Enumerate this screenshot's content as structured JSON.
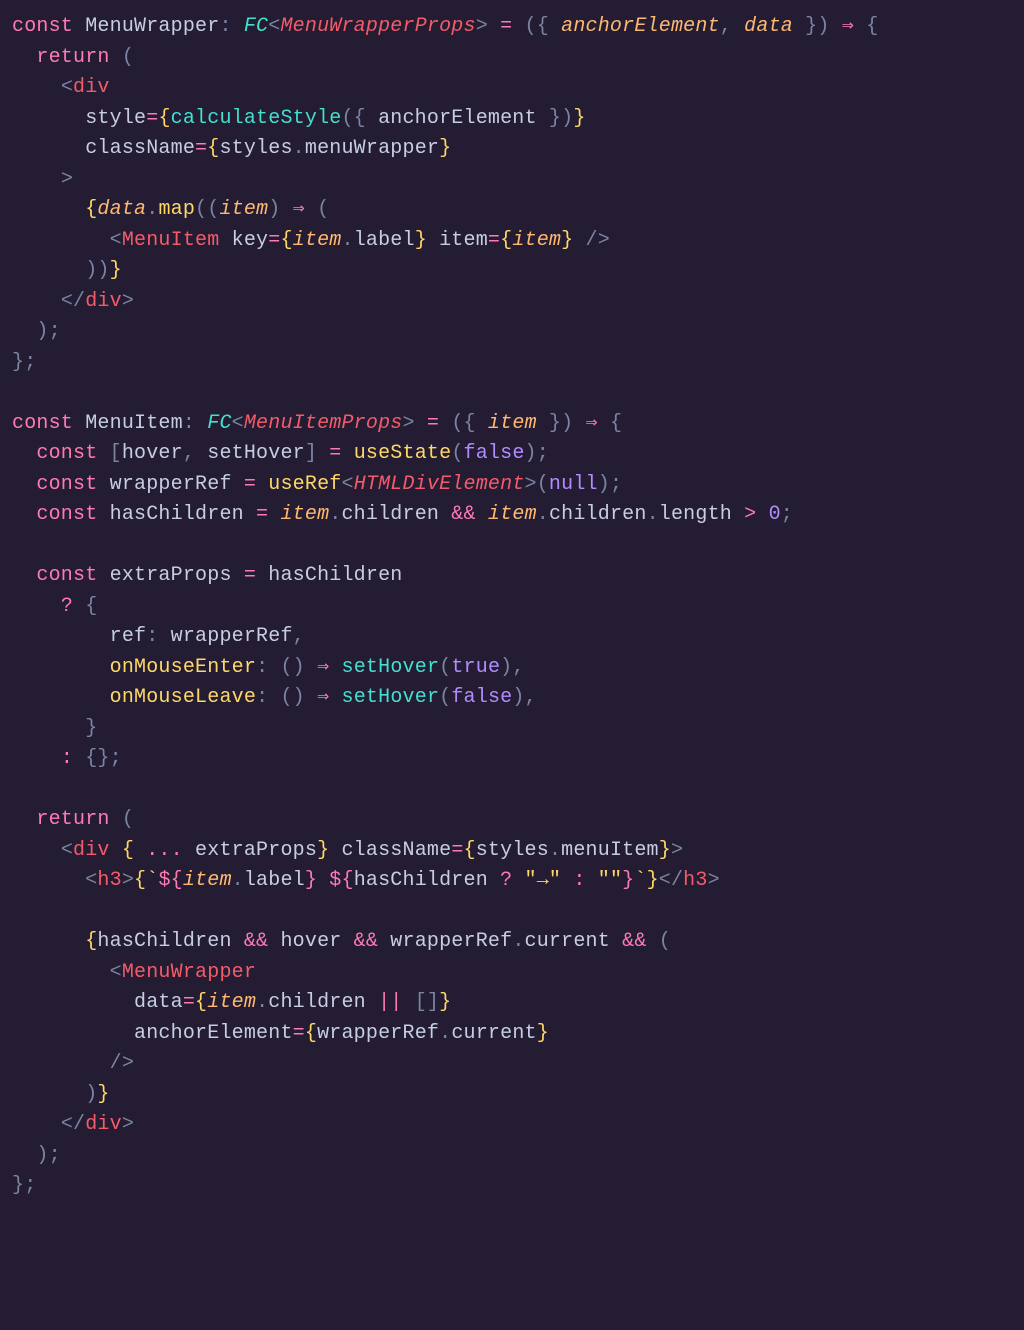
{
  "code": {
    "lines": [
      [
        {
          "t": "const ",
          "c": "c-kw"
        },
        {
          "t": "MenuWrapper",
          "c": "c-ident"
        },
        {
          "t": ": ",
          "c": "c-punc"
        },
        {
          "t": "FC",
          "c": "c-type ital"
        },
        {
          "t": "<",
          "c": "c-punc"
        },
        {
          "t": "MenuWrapperProps",
          "c": "c-comp ital"
        },
        {
          "t": ">",
          "c": "c-punc"
        },
        {
          "t": " = ",
          "c": "c-op"
        },
        {
          "t": "(",
          "c": "c-punc"
        },
        {
          "t": "{ ",
          "c": "c-punc"
        },
        {
          "t": "anchorElement",
          "c": "c-param"
        },
        {
          "t": ", ",
          "c": "c-punc"
        },
        {
          "t": "data",
          "c": "c-param"
        },
        {
          "t": " }",
          "c": "c-punc"
        },
        {
          "t": ")",
          "c": "c-punc"
        },
        {
          "t": " ⇒ ",
          "c": "c-op"
        },
        {
          "t": "{",
          "c": "c-punc"
        }
      ],
      [
        {
          "t": "  ",
          "c": ""
        },
        {
          "t": "return ",
          "c": "c-kw"
        },
        {
          "t": "(",
          "c": "c-punc"
        }
      ],
      [
        {
          "t": "    ",
          "c": ""
        },
        {
          "t": "<",
          "c": "c-tagp"
        },
        {
          "t": "div",
          "c": "c-comp"
        }
      ],
      [
        {
          "t": "      ",
          "c": ""
        },
        {
          "t": "style",
          "c": "c-attr"
        },
        {
          "t": "=",
          "c": "c-op"
        },
        {
          "t": "{",
          "c": "c-brkt"
        },
        {
          "t": "calculateStyle",
          "c": "c-type"
        },
        {
          "t": "(",
          "c": "c-punc"
        },
        {
          "t": "{ ",
          "c": "c-punc"
        },
        {
          "t": "anchorElement",
          "c": "c-ident"
        },
        {
          "t": " }",
          "c": "c-punc"
        },
        {
          "t": ")",
          "c": "c-punc"
        },
        {
          "t": "}",
          "c": "c-brkt"
        }
      ],
      [
        {
          "t": "      ",
          "c": ""
        },
        {
          "t": "className",
          "c": "c-attr"
        },
        {
          "t": "=",
          "c": "c-op"
        },
        {
          "t": "{",
          "c": "c-brkt"
        },
        {
          "t": "styles",
          "c": "c-ident"
        },
        {
          "t": ".",
          "c": "c-punc"
        },
        {
          "t": "menuWrapper",
          "c": "c-prop"
        },
        {
          "t": "}",
          "c": "c-brkt"
        }
      ],
      [
        {
          "t": "    ",
          "c": ""
        },
        {
          "t": ">",
          "c": "c-tagp"
        }
      ],
      [
        {
          "t": "      ",
          "c": ""
        },
        {
          "t": "{",
          "c": "c-brkt"
        },
        {
          "t": "data",
          "c": "c-param"
        },
        {
          "t": ".",
          "c": "c-punc"
        },
        {
          "t": "map",
          "c": "c-fn2"
        },
        {
          "t": "((",
          "c": "c-punc"
        },
        {
          "t": "item",
          "c": "c-param"
        },
        {
          "t": ")",
          "c": "c-punc"
        },
        {
          "t": " ⇒ ",
          "c": "c-op"
        },
        {
          "t": "(",
          "c": "c-punc"
        }
      ],
      [
        {
          "t": "        ",
          "c": ""
        },
        {
          "t": "<",
          "c": "c-tagp"
        },
        {
          "t": "MenuItem",
          "c": "c-comp"
        },
        {
          "t": " ",
          "c": ""
        },
        {
          "t": "key",
          "c": "c-attr"
        },
        {
          "t": "=",
          "c": "c-op"
        },
        {
          "t": "{",
          "c": "c-brkt"
        },
        {
          "t": "item",
          "c": "c-param"
        },
        {
          "t": ".",
          "c": "c-punc"
        },
        {
          "t": "label",
          "c": "c-prop"
        },
        {
          "t": "}",
          "c": "c-brkt"
        },
        {
          "t": " ",
          "c": ""
        },
        {
          "t": "item",
          "c": "c-attr"
        },
        {
          "t": "=",
          "c": "c-op"
        },
        {
          "t": "{",
          "c": "c-brkt"
        },
        {
          "t": "item",
          "c": "c-param"
        },
        {
          "t": "}",
          "c": "c-brkt"
        },
        {
          "t": " ",
          "c": ""
        },
        {
          "t": "/>",
          "c": "c-tagp"
        }
      ],
      [
        {
          "t": "      ",
          "c": ""
        },
        {
          "t": "))",
          "c": "c-punc"
        },
        {
          "t": "}",
          "c": "c-brkt"
        }
      ],
      [
        {
          "t": "    ",
          "c": ""
        },
        {
          "t": "</",
          "c": "c-tagp"
        },
        {
          "t": "div",
          "c": "c-comp"
        },
        {
          "t": ">",
          "c": "c-tagp"
        }
      ],
      [
        {
          "t": "  ",
          "c": ""
        },
        {
          "t": ")",
          "c": "c-punc"
        },
        {
          "t": ";",
          "c": "c-punc"
        }
      ],
      [
        {
          "t": "}",
          "c": "c-punc"
        },
        {
          "t": ";",
          "c": "c-punc"
        }
      ],
      [
        {
          "t": " ",
          "c": ""
        }
      ],
      [
        {
          "t": "const ",
          "c": "c-kw"
        },
        {
          "t": "MenuItem",
          "c": "c-ident"
        },
        {
          "t": ": ",
          "c": "c-punc"
        },
        {
          "t": "FC",
          "c": "c-type ital"
        },
        {
          "t": "<",
          "c": "c-punc"
        },
        {
          "t": "MenuItemProps",
          "c": "c-comp ital"
        },
        {
          "t": ">",
          "c": "c-punc"
        },
        {
          "t": " = ",
          "c": "c-op"
        },
        {
          "t": "(",
          "c": "c-punc"
        },
        {
          "t": "{ ",
          "c": "c-punc"
        },
        {
          "t": "item",
          "c": "c-param"
        },
        {
          "t": " }",
          "c": "c-punc"
        },
        {
          "t": ")",
          "c": "c-punc"
        },
        {
          "t": " ⇒ ",
          "c": "c-op"
        },
        {
          "t": "{",
          "c": "c-punc"
        }
      ],
      [
        {
          "t": "  ",
          "c": ""
        },
        {
          "t": "const ",
          "c": "c-kw"
        },
        {
          "t": "[",
          "c": "c-punc"
        },
        {
          "t": "hover",
          "c": "c-ident"
        },
        {
          "t": ", ",
          "c": "c-punc"
        },
        {
          "t": "setHover",
          "c": "c-ident"
        },
        {
          "t": "]",
          "c": "c-punc"
        },
        {
          "t": " = ",
          "c": "c-op"
        },
        {
          "t": "useState",
          "c": "c-fn2"
        },
        {
          "t": "(",
          "c": "c-punc"
        },
        {
          "t": "false",
          "c": "c-num"
        },
        {
          "t": ")",
          "c": "c-punc"
        },
        {
          "t": ";",
          "c": "c-punc"
        }
      ],
      [
        {
          "t": "  ",
          "c": ""
        },
        {
          "t": "const ",
          "c": "c-kw"
        },
        {
          "t": "wrapperRef",
          "c": "c-ident"
        },
        {
          "t": " = ",
          "c": "c-op"
        },
        {
          "t": "useRef",
          "c": "c-fn2"
        },
        {
          "t": "<",
          "c": "c-punc"
        },
        {
          "t": "HTMLDivElement",
          "c": "c-comp ital"
        },
        {
          "t": ">",
          "c": "c-punc"
        },
        {
          "t": "(",
          "c": "c-punc"
        },
        {
          "t": "null",
          "c": "c-num"
        },
        {
          "t": ")",
          "c": "c-punc"
        },
        {
          "t": ";",
          "c": "c-punc"
        }
      ],
      [
        {
          "t": "  ",
          "c": ""
        },
        {
          "t": "const ",
          "c": "c-kw"
        },
        {
          "t": "hasChildren",
          "c": "c-ident"
        },
        {
          "t": " = ",
          "c": "c-op"
        },
        {
          "t": "item",
          "c": "c-param"
        },
        {
          "t": ".",
          "c": "c-punc"
        },
        {
          "t": "children",
          "c": "c-prop"
        },
        {
          "t": " && ",
          "c": "c-op"
        },
        {
          "t": "item",
          "c": "c-param"
        },
        {
          "t": ".",
          "c": "c-punc"
        },
        {
          "t": "children",
          "c": "c-prop"
        },
        {
          "t": ".",
          "c": "c-punc"
        },
        {
          "t": "length",
          "c": "c-prop"
        },
        {
          "t": " > ",
          "c": "c-op"
        },
        {
          "t": "0",
          "c": "c-num"
        },
        {
          "t": ";",
          "c": "c-punc"
        }
      ],
      [
        {
          "t": " ",
          "c": ""
        }
      ],
      [
        {
          "t": "  ",
          "c": ""
        },
        {
          "t": "const ",
          "c": "c-kw"
        },
        {
          "t": "extraProps",
          "c": "c-ident"
        },
        {
          "t": " = ",
          "c": "c-op"
        },
        {
          "t": "hasChildren",
          "c": "c-ident"
        }
      ],
      [
        {
          "t": "    ",
          "c": ""
        },
        {
          "t": "? ",
          "c": "c-op"
        },
        {
          "t": "{",
          "c": "c-punc"
        }
      ],
      [
        {
          "t": "        ",
          "c": ""
        },
        {
          "t": "ref",
          "c": "c-ident"
        },
        {
          "t": ": ",
          "c": "c-punc"
        },
        {
          "t": "wrapperRef",
          "c": "c-ident"
        },
        {
          "t": ",",
          "c": "c-punc"
        }
      ],
      [
        {
          "t": "        ",
          "c": ""
        },
        {
          "t": "onMouseEnter",
          "c": "c-fn2"
        },
        {
          "t": ": ",
          "c": "c-punc"
        },
        {
          "t": "()",
          "c": "c-punc"
        },
        {
          "t": " ⇒ ",
          "c": "c-op"
        },
        {
          "t": "setHover",
          "c": "c-type"
        },
        {
          "t": "(",
          "c": "c-punc"
        },
        {
          "t": "true",
          "c": "c-num"
        },
        {
          "t": ")",
          "c": "c-punc"
        },
        {
          "t": ",",
          "c": "c-punc"
        }
      ],
      [
        {
          "t": "        ",
          "c": ""
        },
        {
          "t": "onMouseLeave",
          "c": "c-fn2"
        },
        {
          "t": ": ",
          "c": "c-punc"
        },
        {
          "t": "()",
          "c": "c-punc"
        },
        {
          "t": " ⇒ ",
          "c": "c-op"
        },
        {
          "t": "setHover",
          "c": "c-type"
        },
        {
          "t": "(",
          "c": "c-punc"
        },
        {
          "t": "false",
          "c": "c-num"
        },
        {
          "t": ")",
          "c": "c-punc"
        },
        {
          "t": ",",
          "c": "c-punc"
        }
      ],
      [
        {
          "t": "      ",
          "c": ""
        },
        {
          "t": "}",
          "c": "c-punc"
        }
      ],
      [
        {
          "t": "    ",
          "c": ""
        },
        {
          "t": ": ",
          "c": "c-op"
        },
        {
          "t": "{}",
          "c": "c-punc"
        },
        {
          "t": ";",
          "c": "c-punc"
        }
      ],
      [
        {
          "t": " ",
          "c": ""
        }
      ],
      [
        {
          "t": "  ",
          "c": ""
        },
        {
          "t": "return ",
          "c": "c-kw"
        },
        {
          "t": "(",
          "c": "c-punc"
        }
      ],
      [
        {
          "t": "    ",
          "c": ""
        },
        {
          "t": "<",
          "c": "c-tagp"
        },
        {
          "t": "div",
          "c": "c-comp"
        },
        {
          "t": " ",
          "c": ""
        },
        {
          "t": "{",
          "c": "c-brkt"
        },
        {
          "t": " ... ",
          "c": "c-op"
        },
        {
          "t": "extraProps",
          "c": "c-ident"
        },
        {
          "t": "}",
          "c": "c-brkt"
        },
        {
          "t": " ",
          "c": ""
        },
        {
          "t": "className",
          "c": "c-attr"
        },
        {
          "t": "=",
          "c": "c-op"
        },
        {
          "t": "{",
          "c": "c-brkt"
        },
        {
          "t": "styles",
          "c": "c-ident"
        },
        {
          "t": ".",
          "c": "c-punc"
        },
        {
          "t": "menuItem",
          "c": "c-prop"
        },
        {
          "t": "}",
          "c": "c-brkt"
        },
        {
          "t": ">",
          "c": "c-tagp"
        }
      ],
      [
        {
          "t": "      ",
          "c": ""
        },
        {
          "t": "<",
          "c": "c-tagp"
        },
        {
          "t": "h3",
          "c": "c-comp"
        },
        {
          "t": ">",
          "c": "c-tagp"
        },
        {
          "t": "{",
          "c": "c-brkt"
        },
        {
          "t": "`",
          "c": "c-str"
        },
        {
          "t": "${",
          "c": "c-op"
        },
        {
          "t": "item",
          "c": "c-param"
        },
        {
          "t": ".",
          "c": "c-punc"
        },
        {
          "t": "label",
          "c": "c-prop"
        },
        {
          "t": "}",
          "c": "c-op"
        },
        {
          "t": " ",
          "c": "c-str"
        },
        {
          "t": "${",
          "c": "c-op"
        },
        {
          "t": "hasChildren",
          "c": "c-ident"
        },
        {
          "t": " ? ",
          "c": "c-op"
        },
        {
          "t": "\"→\"",
          "c": "c-str"
        },
        {
          "t": " : ",
          "c": "c-op"
        },
        {
          "t": "\"\"",
          "c": "c-str"
        },
        {
          "t": "}",
          "c": "c-op"
        },
        {
          "t": "`",
          "c": "c-str"
        },
        {
          "t": "}",
          "c": "c-brkt"
        },
        {
          "t": "</",
          "c": "c-tagp"
        },
        {
          "t": "h3",
          "c": "c-comp"
        },
        {
          "t": ">",
          "c": "c-tagp"
        }
      ],
      [
        {
          "t": " ",
          "c": ""
        }
      ],
      [
        {
          "t": "      ",
          "c": ""
        },
        {
          "t": "{",
          "c": "c-brkt"
        },
        {
          "t": "hasChildren",
          "c": "c-ident"
        },
        {
          "t": " && ",
          "c": "c-op"
        },
        {
          "t": "hover",
          "c": "c-ident"
        },
        {
          "t": " && ",
          "c": "c-op"
        },
        {
          "t": "wrapperRef",
          "c": "c-ident"
        },
        {
          "t": ".",
          "c": "c-punc"
        },
        {
          "t": "current",
          "c": "c-prop"
        },
        {
          "t": " && ",
          "c": "c-op"
        },
        {
          "t": "(",
          "c": "c-punc"
        }
      ],
      [
        {
          "t": "        ",
          "c": ""
        },
        {
          "t": "<",
          "c": "c-tagp"
        },
        {
          "t": "MenuWrapper",
          "c": "c-comp"
        }
      ],
      [
        {
          "t": "          ",
          "c": ""
        },
        {
          "t": "data",
          "c": "c-attr"
        },
        {
          "t": "=",
          "c": "c-op"
        },
        {
          "t": "{",
          "c": "c-brkt"
        },
        {
          "t": "item",
          "c": "c-param"
        },
        {
          "t": ".",
          "c": "c-punc"
        },
        {
          "t": "children",
          "c": "c-prop"
        },
        {
          "t": " || ",
          "c": "c-op"
        },
        {
          "t": "[]",
          "c": "c-punc"
        },
        {
          "t": "}",
          "c": "c-brkt"
        }
      ],
      [
        {
          "t": "          ",
          "c": ""
        },
        {
          "t": "anchorElement",
          "c": "c-attr"
        },
        {
          "t": "=",
          "c": "c-op"
        },
        {
          "t": "{",
          "c": "c-brkt"
        },
        {
          "t": "wrapperRef",
          "c": "c-ident"
        },
        {
          "t": ".",
          "c": "c-punc"
        },
        {
          "t": "current",
          "c": "c-prop"
        },
        {
          "t": "}",
          "c": "c-brkt"
        }
      ],
      [
        {
          "t": "        ",
          "c": ""
        },
        {
          "t": "/>",
          "c": "c-tagp"
        }
      ],
      [
        {
          "t": "      ",
          "c": ""
        },
        {
          "t": ")",
          "c": "c-punc"
        },
        {
          "t": "}",
          "c": "c-brkt"
        }
      ],
      [
        {
          "t": "    ",
          "c": ""
        },
        {
          "t": "</",
          "c": "c-tagp"
        },
        {
          "t": "div",
          "c": "c-comp"
        },
        {
          "t": ">",
          "c": "c-tagp"
        }
      ],
      [
        {
          "t": "  ",
          "c": ""
        },
        {
          "t": ")",
          "c": "c-punc"
        },
        {
          "t": ";",
          "c": "c-punc"
        }
      ],
      [
        {
          "t": "}",
          "c": "c-punc"
        },
        {
          "t": ";",
          "c": "c-punc"
        }
      ]
    ]
  }
}
